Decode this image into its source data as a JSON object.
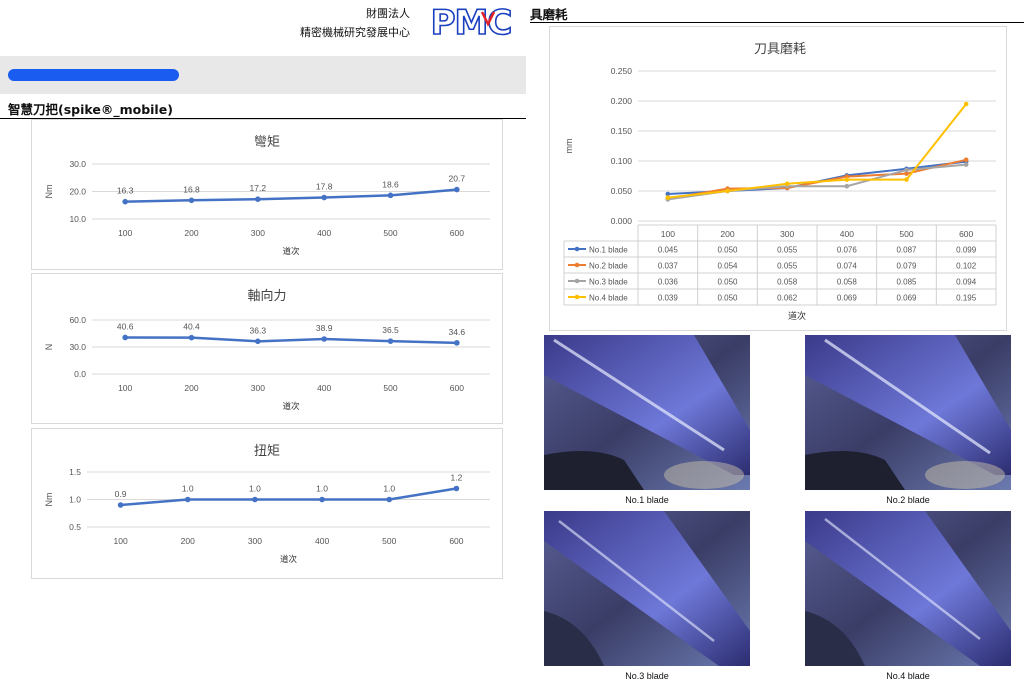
{
  "header": {
    "org_line1": "財團法人",
    "org_line2": "精密機械研究發展中心",
    "logo_text": "PMC"
  },
  "left": {
    "section_title": "智慧刀把(spike®_mobile)"
  },
  "right": {
    "section_title": "具磨耗"
  },
  "colors": {
    "primary_line": "#4472c4",
    "series": [
      "#4472c4",
      "#ed7d31",
      "#a5a5a5",
      "#ffc000"
    ],
    "logo_blue": "#1a3fbf",
    "logo_red": "#e21f26"
  },
  "chart_data": [
    {
      "id": "bending",
      "type": "line",
      "title": "彎矩",
      "xlabel": "道次",
      "ylabel": "Nm",
      "categories": [
        "100",
        "200",
        "300",
        "400",
        "500",
        "600"
      ],
      "series": [
        {
          "values": [
            16.3,
            16.8,
            17.2,
            17.8,
            18.6,
            20.7
          ]
        }
      ],
      "value_labels": [
        "16.3",
        "16.8",
        "17.2",
        "17.8",
        "18.6",
        "20.7"
      ],
      "yticks": [
        "10.0",
        "20.0",
        "30.0"
      ],
      "ylim": [
        10,
        30
      ],
      "grid": true
    },
    {
      "id": "axial",
      "type": "line",
      "title": "軸向力",
      "xlabel": "道次",
      "ylabel": "N",
      "categories": [
        "100",
        "200",
        "300",
        "400",
        "500",
        "600"
      ],
      "series": [
        {
          "values": [
            40.6,
            40.4,
            36.3,
            38.9,
            36.5,
            34.6
          ]
        }
      ],
      "value_labels": [
        "40.6",
        "40.4",
        "36.3",
        "38.9",
        "36.5",
        "34.6"
      ],
      "yticks": [
        "0.0",
        "30.0",
        "60.0"
      ],
      "ylim": [
        0,
        60
      ],
      "grid": true
    },
    {
      "id": "torque",
      "type": "line",
      "title": "扭矩",
      "xlabel": "道次",
      "ylabel": "Nm",
      "categories": [
        "100",
        "200",
        "300",
        "400",
        "500",
        "600"
      ],
      "series": [
        {
          "values": [
            0.9,
            1.0,
            1.0,
            1.0,
            1.0,
            1.2
          ]
        }
      ],
      "value_labels": [
        "0.9",
        "1.0",
        "1.0",
        "1.0",
        "1.0",
        "1.2"
      ],
      "yticks": [
        "0.5",
        "1.0",
        "1.5"
      ],
      "ylim": [
        0.5,
        1.5
      ],
      "grid": true
    },
    {
      "id": "wear",
      "type": "line",
      "title": "刀具磨耗",
      "xlabel": "道次",
      "ylabel": "mm",
      "categories": [
        "100",
        "200",
        "300",
        "400",
        "500",
        "600"
      ],
      "yticks": [
        "0.000",
        "0.050",
        "0.100",
        "0.150",
        "0.200",
        "0.250"
      ],
      "ylim": [
        0,
        0.25
      ],
      "grid": true,
      "legend": "data-table",
      "series": [
        {
          "name": "No.1 blade",
          "values": [
            0.045,
            0.05,
            0.055,
            0.076,
            0.087,
            0.099
          ],
          "labels": [
            "0.045",
            "0.050",
            "0.055",
            "0.076",
            "0.087",
            "0.099"
          ]
        },
        {
          "name": "No.2 blade",
          "values": [
            0.037,
            0.054,
            0.055,
            0.074,
            0.079,
            0.102
          ],
          "labels": [
            "0.037",
            "0.054",
            "0.055",
            "0.074",
            "0.079",
            "0.102"
          ]
        },
        {
          "name": "No.3 blade",
          "values": [
            0.036,
            0.05,
            0.058,
            0.058,
            0.085,
            0.094
          ],
          "labels": [
            "0.036",
            "0.050",
            "0.058",
            "0.058",
            "0.085",
            "0.094"
          ]
        },
        {
          "name": "No.4 blade",
          "values": [
            0.039,
            0.05,
            0.062,
            0.069,
            0.069,
            0.195
          ],
          "labels": [
            "0.039",
            "0.050",
            "0.062",
            "0.069",
            "0.069",
            "0.195"
          ]
        }
      ]
    }
  ],
  "photos": [
    {
      "caption": "No.1 blade"
    },
    {
      "caption": "No.2 blade"
    },
    {
      "caption": "No.3 blade"
    },
    {
      "caption": "No.4 blade"
    }
  ]
}
